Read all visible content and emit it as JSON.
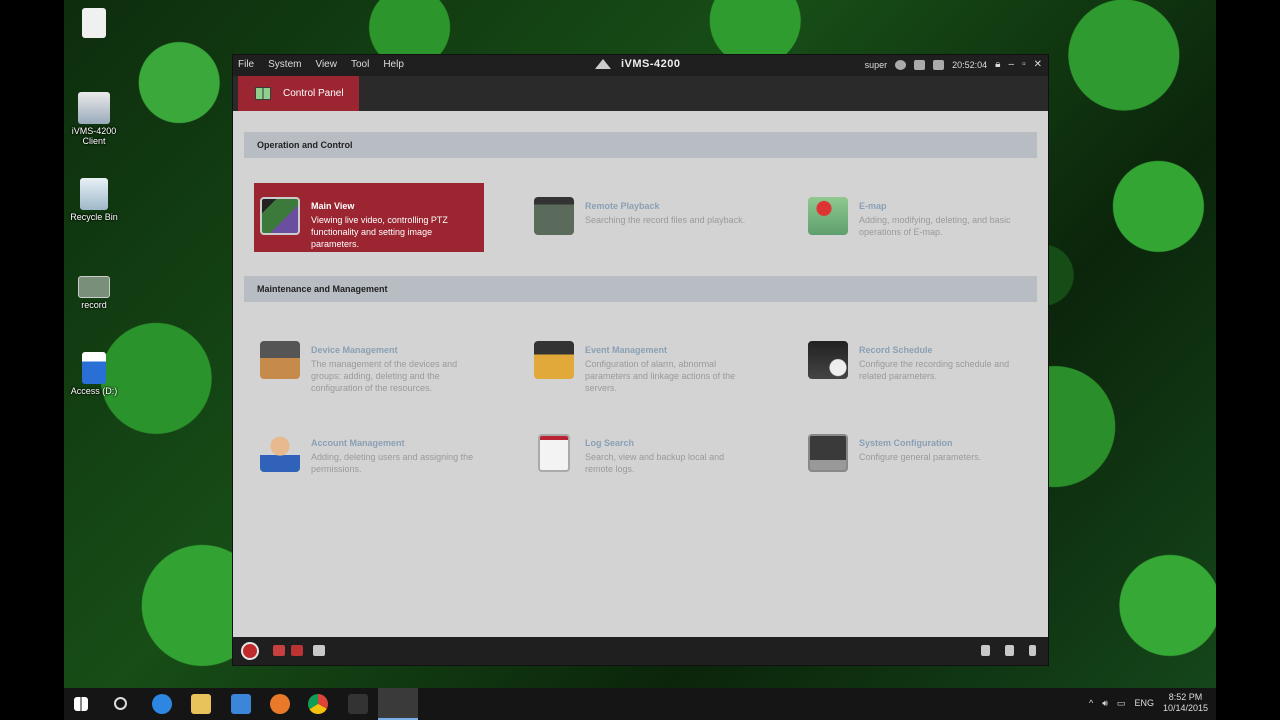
{
  "desktop": {
    "icons": [
      {
        "label": "iVMS-4200 Client"
      },
      {
        "label": "Recycle Bin"
      },
      {
        "label": "record"
      },
      {
        "label": "Access (D:)"
      }
    ]
  },
  "app": {
    "menu": [
      "File",
      "System",
      "View",
      "Tool",
      "Help"
    ],
    "title": "iVMS-4200",
    "user": "super",
    "time": "20:52:04",
    "tab_label": "Control Panel",
    "sections": [
      {
        "heading": "Operation and Control",
        "items": [
          {
            "title": "Main View",
            "desc": "Viewing live video, controlling PTZ functionality and setting image parameters.",
            "icon": "main-view-icon",
            "active": true
          },
          {
            "title": "Remote Playback",
            "desc": "Searching the record files and playback.",
            "icon": "remote-playback-icon"
          },
          {
            "title": "E-map",
            "desc": "Adding, modifying, deleting, and basic operations of E-map.",
            "icon": "e-map-icon"
          }
        ]
      },
      {
        "heading": "Maintenance and Management",
        "items": [
          {
            "title": "Device Management",
            "desc": "The management of the devices and groups: adding, deleting and the configuration of the resources.",
            "icon": "device-management-icon"
          },
          {
            "title": "Event Management",
            "desc": "Configuration of alarm, abnormal parameters and linkage actions of the servers.",
            "icon": "event-management-icon"
          },
          {
            "title": "Record Schedule",
            "desc": "Configure the recording schedule and related parameters.",
            "icon": "record-schedule-icon"
          },
          {
            "title": "Account Management",
            "desc": "Adding, deleting users and assigning the permissions.",
            "icon": "account-management-icon"
          },
          {
            "title": "Log Search",
            "desc": "Search, view and backup local and remote logs.",
            "icon": "log-search-icon"
          },
          {
            "title": "System Configuration",
            "desc": "Configure general parameters.",
            "icon": "system-configuration-icon"
          }
        ]
      }
    ]
  },
  "taskbar": {
    "language": "ENG",
    "clock_time": "8:52 PM",
    "clock_date": "10/14/2015"
  },
  "colors": {
    "accent": "#9b2530",
    "section_bg": "#b7bdc2",
    "window_bg": "#d3d3d3",
    "title_link": "#8aa0b5"
  }
}
